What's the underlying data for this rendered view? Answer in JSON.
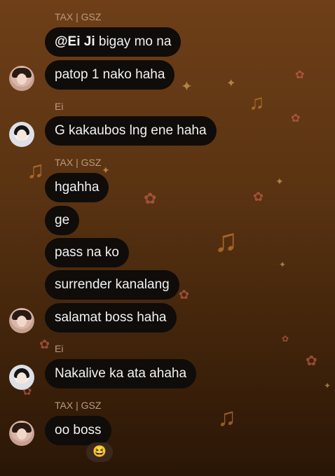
{
  "messages": [
    {
      "sender": "TAX | GSZ",
      "bubbles": [
        {
          "mention": "@Ei Ji",
          "text": " bigay mo na"
        },
        {
          "text": "patop 1 nako haha"
        }
      ]
    },
    {
      "sender": "Ei",
      "bubbles": [
        {
          "text": "G kakaubos lng ene haha"
        }
      ]
    },
    {
      "sender": "TAX | GSZ",
      "bubbles": [
        {
          "text": "hgahha"
        },
        {
          "text": "ge"
        },
        {
          "text": "pass na ko"
        },
        {
          "text": "surrender kanalang"
        },
        {
          "text": "salamat boss haha"
        }
      ]
    },
    {
      "sender": "Ei",
      "bubbles": [
        {
          "text": "Nakalive ka ata ahaha"
        }
      ]
    },
    {
      "sender": "TAX | GSZ",
      "bubbles": [
        {
          "text": "oo boss"
        }
      ]
    }
  ],
  "reaction": {
    "emoji": "😆"
  },
  "decorations": {
    "note_icon": "♫",
    "flower_icon": "✿",
    "sparkle_icon": "✦"
  },
  "colors": {
    "bubble": "#0f0c0a",
    "sender_text": "#b99a82",
    "background_top": "#6e3f18",
    "background_bottom": "#2a1606"
  }
}
